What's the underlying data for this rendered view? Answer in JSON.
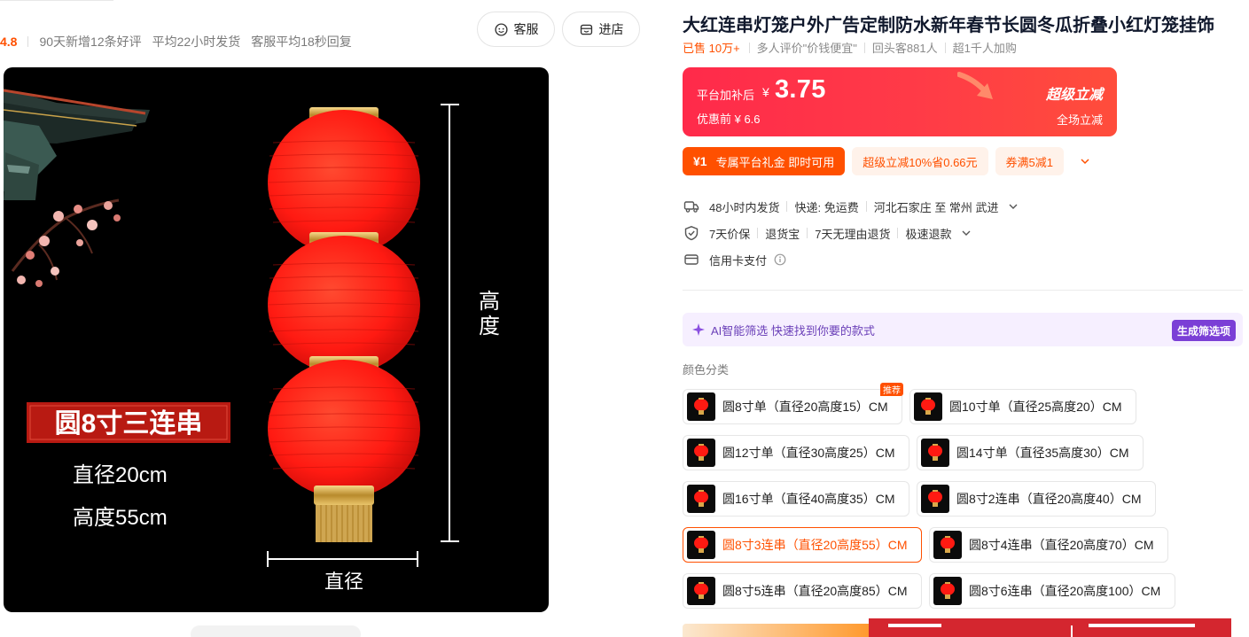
{
  "shop": {
    "rating": "4.8",
    "stats": [
      "90天新增12条好评",
      "平均22小时发货",
      "客服平均18秒回复"
    ],
    "service_button": "客服",
    "enter_shop_button": "进店"
  },
  "image": {
    "badge_text": "圆8寸三连串",
    "diameter_text": "直径20cm",
    "height_text": "高度55cm",
    "height_axis_label": "高\n度",
    "height_axis_line1": "高",
    "height_axis_line2": "度",
    "diameter_axis_label": "直径"
  },
  "product": {
    "title": "大红连串灯笼户外广告定制防水新年春节长圆冬瓜折叠小红灯笼挂饰",
    "sold": "已售 10万+",
    "meta": [
      "多人评价\"价钱便宜\"",
      "回头客881人",
      "超1千人加购"
    ]
  },
  "price": {
    "label": "平台加补后",
    "currency": "¥",
    "amount": "3.75",
    "before": "优惠前 ¥ 6.6",
    "promo_brand": "超级立减",
    "promo_sub": "全场立减"
  },
  "coupons": {
    "main_amount": "¥1",
    "main_text": "专属平台礼金 即时可用",
    "tags": [
      "超级立减10%省0.66元",
      "券满5减1"
    ]
  },
  "services": {
    "shipping": [
      "48小时内发货",
      "快递: 免运费",
      "河北石家庄 至 常州 武进"
    ],
    "guarantee": [
      "7天价保",
      "退货宝",
      "7天无理由退货",
      "极速退款"
    ],
    "payment": "信用卡支付"
  },
  "ai": {
    "text": "AI智能筛选 快速找到你要的款式",
    "button": "生成筛选项"
  },
  "spec": {
    "label": "颜色分类",
    "recommend_badge": "推荐",
    "options": [
      "圆8寸单（直径20高度15）CM",
      "圆10寸单（直径25高度20）CM",
      "圆12寸单（直径30高度25）CM",
      "圆14寸单（直径35高度30）CM",
      "圆16寸单（直径40高度35）CM",
      "圆8寸2连串（直径20高度40）CM",
      "圆8寸3连串（直径20高度55）CM",
      "圆8寸4连串（直径20高度70）CM",
      "圆8寸5连串（直径20高度85）CM",
      "圆8寸6连串（直径20高度100）CM"
    ],
    "selected_index": 6
  },
  "colors": {
    "accent": "#ff5000",
    "price_red": "#ff2a4a",
    "lantern_red": "#ff1a12",
    "ai_purple": "#7b3fd6"
  }
}
